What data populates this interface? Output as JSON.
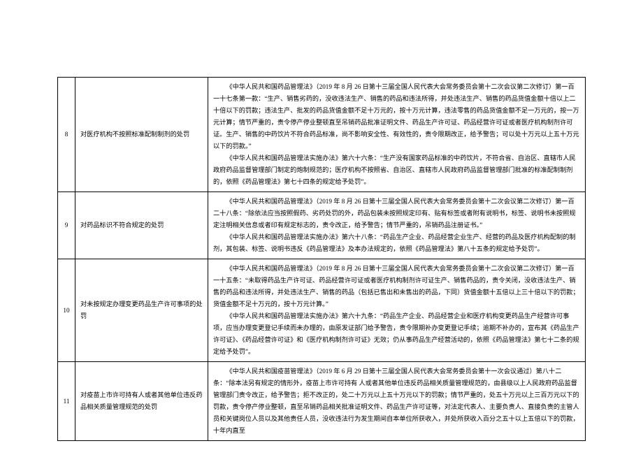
{
  "rows": [
    {
      "num": "8",
      "title": "对医疗机构不按照标准配制制剂的处罚",
      "body_paras": [
        "《中华人民共和国药品管理法》（2019 年 8 月 26 日第十三届全国人民代表大会常务委员会第十二次会议第二次修订）第一百一十七条第一款：“生产、销售劣药的，没收违法生产、销售的药品和违法所得，并处违法生产、销售的药品货值金额十倍以上二十倍以下的罚款；违法生产、批发的药品货值金额不足十万元的，按十万元计算，违法零售的药品货值金额不足一万元的，按一万元计算；情节严重的，责令停产停业整顿直至吊销药品批准证明文件、药品生产许可证、药品经营许可证或者医疗机构制剂许可证。生产、销售的中药饮片不符合药品标准，尚不影响安全性、有效性的，责令限期改正，给予警告；可以处十万元以上五十万元以下的罚款。”",
        "《中华人民共和国药品管理法实施办法》第六十六条：“生产没有国家药品标准的中药饮片，不符合省、自治区、直辖市人民政府药品监督管理部门制定的炮制规范的；医疗机构不按照省、自治区、直辖市人民政府药品监督管理部门批准的标准配制制剂的，依照《药品管理法》第七十四条的规定给予处罚”。"
      ]
    },
    {
      "num": "9",
      "title": "对药品标识不符合规定的处罚",
      "body_paras": [
        "《中华人民共和国药品管理法》（2019 年 8 月 26 日第十三届全国人民代表大会常务委员会第十二次会议第二次修订）第一百二十八条：“除依法应当按照假药、劣药处罚的外，药品包装未按照规定印有、贴有标签或者附有说明书，标签、说明书未按照规定注明相关信息或者印有规定标志的，责令改正，给予警告；情节严重的，吊销药品注册证书。”",
        "《中华人民共和国药品管理法实施办法》第六十八条：“药品生产企业、药品经营企业生产、经营的药品及医疗机构配制的制剂，其包装、标签、说明书违反《药品管理法》及本办法规定的，依照《药品管理法》第八十五条的规定给予处罚”。"
      ]
    },
    {
      "num": "10",
      "title": "对未按规定办理变更药品生产许可事项的处罚",
      "body_paras": [
        "《中华人民共和国药品管理法》（2019 年 8 月 26 日第十三届全国人民代表大会常务委员会第十二次会议第二次修订）第一百一十五条：“未取得药品生产许可证、药品经营许可证或者医疗机构制剂许可证生产、销售药品的，责令关闭，没收违法生产、销售的药品和违法所得，并处违法生产、销售的药品（包括已售出和未售出的药品，下同）货值金额十五倍以上三十倍以下的罚款；货值金额不足十万元的，按十万元计算。”",
        "《中华人民共和国药品管理法实施办法》第六十九条：“药品生产企业、药品经营企业和医疗机构变更药品生产经营许可事项，应当办理变更登记手续而未办理的，由原发证部门给予警告，责令限期补办变更登记手续；逾期不补办的，宣布其《药品生产许可证》、《药品经营许可证》和《医疗机构制剂许可证》无效；仍从事药品生产经营活动的，依照《药品管理法》第七十二条的规定给予处罚”。"
      ]
    },
    {
      "num": "11",
      "title": "对疫苗上市许可持有人或者其他单位违反药品相关质量管理规范的处罚",
      "body_paras": [
        "《中华人民共和国疫苗管理法》（2019 年 6 月 29 日第十三届全国人民代表大会常务委员会第十一次会议通过）第八十二条：“除本法另有规定的情形外，疫苗上市许可持有 人或者其他单位违反药品相关质量管理规范的，由县级以上人民政府药品监督管理部门责令改正，给予警告；拒不改正的，处二十万元以上五十万元以下的罚款；情节严重的，处五十万元以上三百万元以下的罚款，责令停产停业整顿，直至吊销药品相关批准证明文件、药品生产许可证等，对法定代表人、主要负责人、直接负责的主管人员和关键岗位人员以及其他责任人员，没收违法行为发生期间自本单位所获收入，并处所获收入百分之五十以上五倍以下的罚款，十年内直至"
      ]
    }
  ]
}
